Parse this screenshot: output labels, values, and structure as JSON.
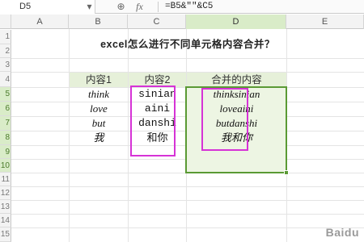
{
  "formula_bar": {
    "cell_ref": "D5",
    "zoom_icon": "zoom-icon",
    "fx_label": "fx",
    "formula": "=B5&\"\"&C5"
  },
  "columns": [
    "A",
    "B",
    "C",
    "D",
    "E"
  ],
  "rows": [
    "1",
    "2",
    "3",
    "4",
    "5",
    "6",
    "7",
    "8",
    "9",
    "10",
    "11",
    "12",
    "13",
    "14",
    "15"
  ],
  "sheet": {
    "title": "excel怎么进行不同单元格内容合并？",
    "headers": [
      "内容1",
      "内容2",
      "合并的内容"
    ],
    "data": [
      [
        "think",
        "sinian",
        "thinksinian"
      ],
      [
        "love",
        "aini",
        "loveaini"
      ],
      [
        "but",
        "danshi",
        "butdanshi"
      ],
      [
        "我",
        "和你",
        "我和你"
      ]
    ]
  },
  "colors": {
    "selection_border": "#5a9a34",
    "highlight_box": "#d633d6",
    "header_fill": "#e6f0d9"
  },
  "watermark": "Baidu"
}
